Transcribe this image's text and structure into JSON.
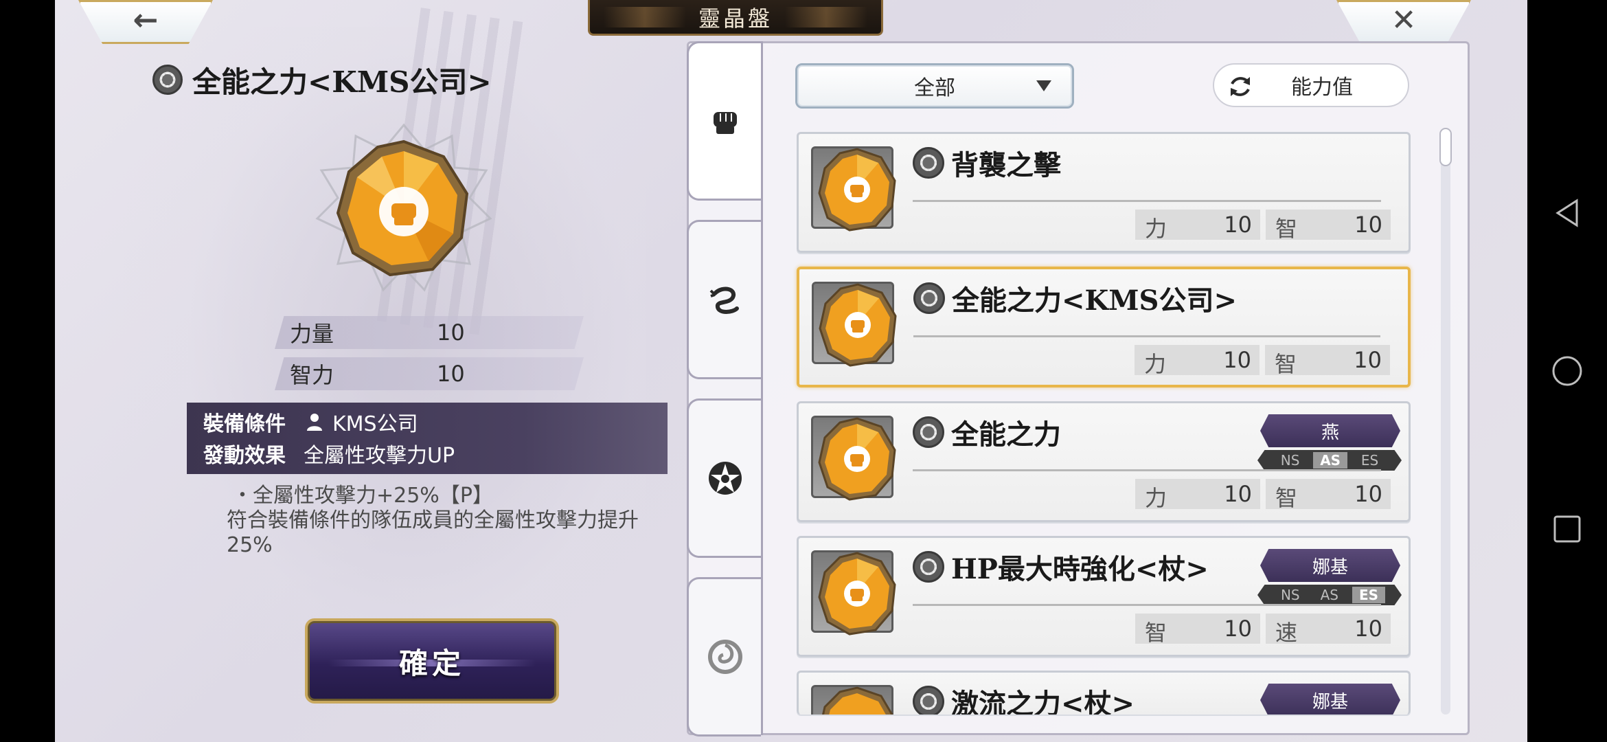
{
  "header": {
    "title": "靈晶盤"
  },
  "back_button": {
    "glyph": "←"
  },
  "close_button": {
    "glyph": "✕"
  },
  "detail": {
    "name": "全能之力<KMS公司>",
    "stats": [
      {
        "label": "力量",
        "value": "10"
      },
      {
        "label": "智力",
        "value": "10"
      }
    ],
    "equip_condition_label": "裝備條件",
    "equip_condition_value": "KMS公司",
    "effect_label": "發動效果",
    "effect_value": "全屬性攻擊力UP",
    "description_line1": "・全屬性攻擊力+25%【P】",
    "description_line2": "符合裝備條件的隊伍成員的全屬性攻擊力提升25%",
    "confirm_label": "確定"
  },
  "filter": {
    "selected": "全部"
  },
  "stat_toggle": {
    "label": "能力值"
  },
  "tabs": [
    {
      "icon": "fist-icon"
    },
    {
      "icon": "dragon-icon"
    },
    {
      "icon": "star-emblem-icon"
    },
    {
      "icon": "swirl-icon"
    }
  ],
  "cards": [
    {
      "name": "背襲之擊",
      "stats": [
        {
          "k": "力",
          "v": "10"
        },
        {
          "k": "智",
          "v": "10"
        }
      ]
    },
    {
      "name": "全能之力<KMS公司>",
      "stats": [
        {
          "k": "力",
          "v": "10"
        },
        {
          "k": "智",
          "v": "10"
        }
      ],
      "selected": true
    },
    {
      "name": "全能之力",
      "character": "燕",
      "modes": [
        "NS",
        "AS",
        "ES"
      ],
      "active_mode": "AS",
      "stats": [
        {
          "k": "力",
          "v": "10"
        },
        {
          "k": "智",
          "v": "10"
        }
      ]
    },
    {
      "name": "HP最大時強化<杖>",
      "character": "娜基",
      "modes": [
        "NS",
        "AS",
        "ES"
      ],
      "active_mode": "ES",
      "stats": [
        {
          "k": "智",
          "v": "10"
        },
        {
          "k": "速",
          "v": "10"
        }
      ]
    },
    {
      "name": "激流之力<杖>",
      "character": "娜基"
    }
  ],
  "colors": {
    "accent_gold": "#e8b64a",
    "panel_purple": "#3d3550",
    "crystal_orange": "#f0a020"
  }
}
